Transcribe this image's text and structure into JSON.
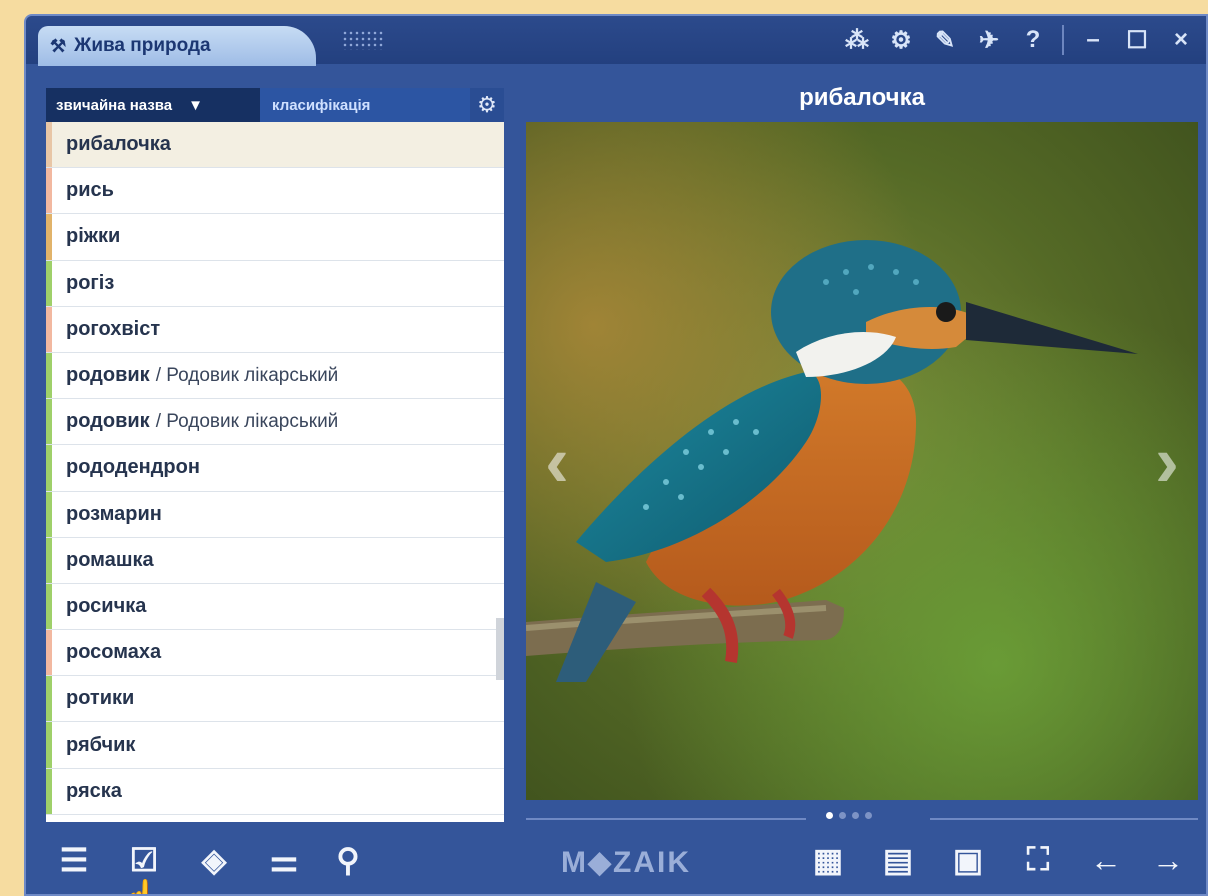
{
  "app": {
    "title": "Жива природа",
    "wand_icon": "wand-icon",
    "tools": [
      "molecule-icon",
      "bike-icon",
      "pencil-icon",
      "pin-icon",
      "?",
      "–",
      "☐",
      "×"
    ]
  },
  "list": {
    "header_common": "звичайна назва",
    "header_class": "класифікація",
    "items": [
      {
        "name": "рибалочка",
        "sub": "",
        "color": "#e8c6a6"
      },
      {
        "name": "рись",
        "sub": "",
        "color": "#f2b8a0"
      },
      {
        "name": "ріжки",
        "sub": "",
        "color": "#e1b36a"
      },
      {
        "name": "рогіз",
        "sub": "",
        "color": "#9fd06a"
      },
      {
        "name": "рогохвіст",
        "sub": "",
        "color": "#f2b8a0"
      },
      {
        "name": "родовик",
        "sub": "/ Родовик лікарський",
        "color": "#9fd06a"
      },
      {
        "name": "родовик",
        "sub": "/ Родовик лікарський",
        "color": "#9fd06a"
      },
      {
        "name": "рододендрон",
        "sub": "",
        "color": "#9fd06a"
      },
      {
        "name": "розмарин",
        "sub": "",
        "color": "#9fd06a"
      },
      {
        "name": "ромашка",
        "sub": "",
        "color": "#9fd06a"
      },
      {
        "name": "росичка",
        "sub": "",
        "color": "#9fd06a"
      },
      {
        "name": "росомаха",
        "sub": "",
        "color": "#f2b8a0"
      },
      {
        "name": "ротики",
        "sub": "",
        "color": "#9fd06a"
      },
      {
        "name": "рябчик",
        "sub": "",
        "color": "#9fd06a"
      },
      {
        "name": "ряска",
        "sub": "",
        "color": "#9fd06a"
      }
    ]
  },
  "viewer": {
    "title": "рибалочка",
    "prev": "‹",
    "next": "›",
    "page_dots": 4,
    "active_dot": 0
  },
  "bottom": {
    "brand": "M◆ZAIK"
  }
}
